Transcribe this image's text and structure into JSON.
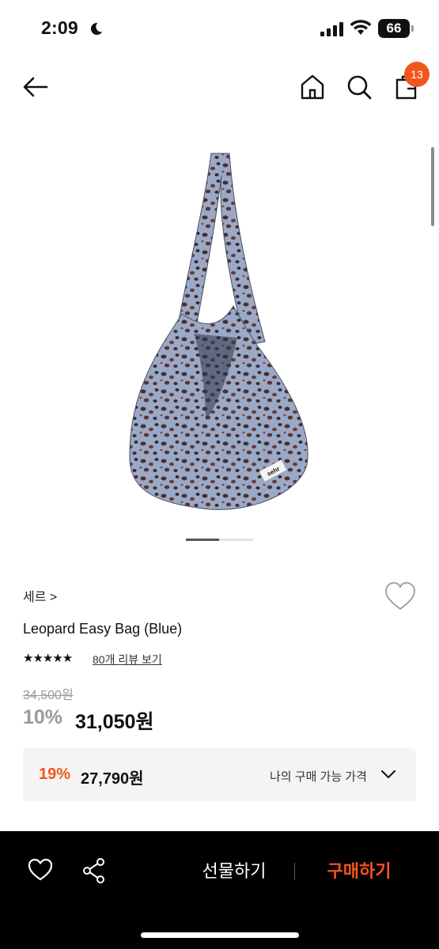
{
  "status_bar": {
    "time": "2:09",
    "battery": "66"
  },
  "nav": {
    "cart_count": "13"
  },
  "product": {
    "brand": "세르 >",
    "title": "Leopard Easy Bag (Blue)",
    "stars": "★★★★★",
    "review_link": "80개 리뷰 보기",
    "original_price": "34,500원",
    "discount_rate": "10%",
    "sale_price": "31,050원"
  },
  "member_price": {
    "rate": "19%",
    "price": "27,790원",
    "label": "나의 구매 가능 가격"
  },
  "bottom_bar": {
    "gift_label": "선물하기",
    "buy_label": "구매하기"
  },
  "image": {
    "label_tag": "sehr"
  },
  "colors": {
    "accent": "#f2561d",
    "bag_base": "#9aa9c7",
    "bag_spot": "#4a2e28"
  }
}
